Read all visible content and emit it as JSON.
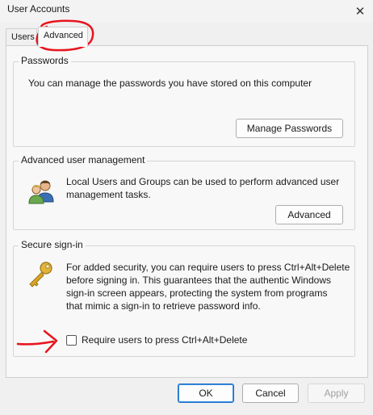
{
  "window": {
    "title": "User Accounts",
    "close_glyph": "✕",
    "close_icon": "close-icon"
  },
  "tabs": [
    {
      "label": "Users",
      "selected": false
    },
    {
      "label": "Advanced",
      "selected": true
    }
  ],
  "passwords": {
    "legend": "Passwords",
    "description": "You can manage the passwords you have stored on this computer",
    "button_label": "Manage Passwords"
  },
  "advanced_user_management": {
    "legend": "Advanced user management",
    "description_line1": "Local Users and Groups can be used to perform advanced user",
    "description_line2": "management tasks.",
    "button_label": "Advanced",
    "icon": "users-group-icon"
  },
  "secure_sign_in": {
    "legend": "Secure sign-in",
    "description_lines": [
      "For added security, you can require users to press Ctrl+Alt+Delete",
      "before signing in. This guarantees that the authentic Windows",
      "sign-in screen appears, protecting the system from programs",
      "that mimic a sign-in to retrieve password info."
    ],
    "icon": "key-icon",
    "checkbox_label": "Require users to press Ctrl+Alt+Delete",
    "checkbox_checked": false
  },
  "footer": {
    "ok_label": "OK",
    "cancel_label": "Cancel",
    "apply_label": "Apply",
    "apply_enabled": false
  },
  "colors": {
    "annotation_red": "#e8141e",
    "primary_border": "#1a6fc9"
  }
}
